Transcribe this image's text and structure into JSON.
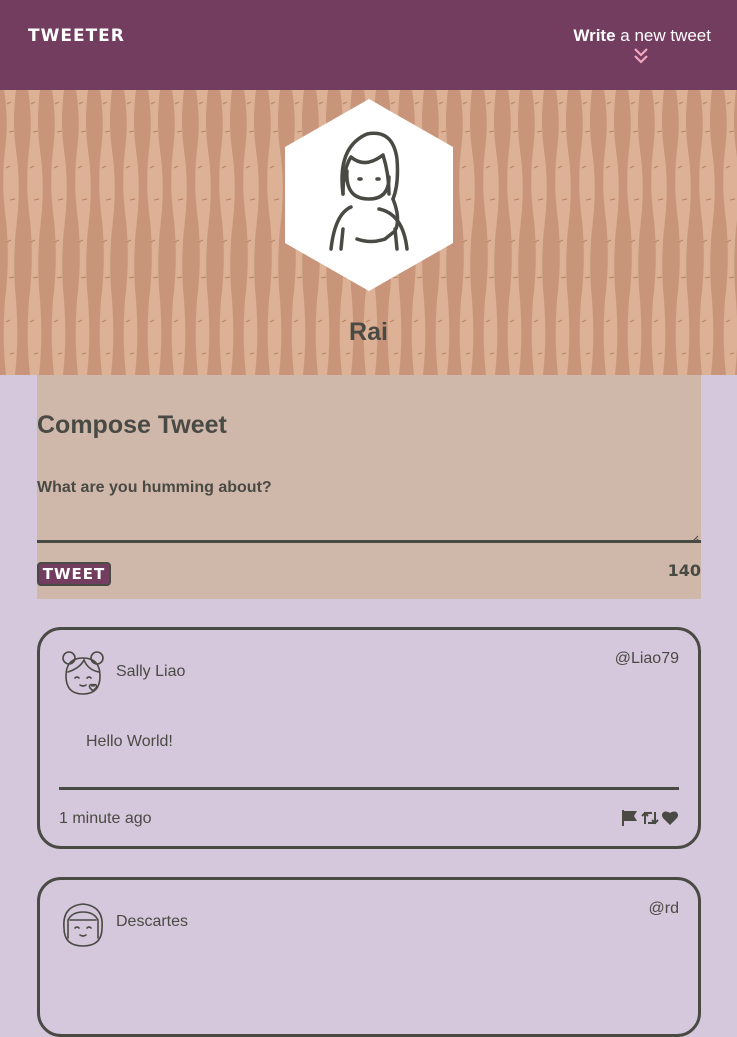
{
  "nav": {
    "brand": "TWEETER",
    "write_bold": "Write",
    "write_rest": " a new tweet",
    "toggle_icon": "double-chevron-down-icon"
  },
  "profile": {
    "name": "Rai",
    "avatar_icon": "girl-avatar-icon"
  },
  "compose": {
    "heading": "Compose Tweet",
    "placeholder": "What are you humming about?",
    "value": "",
    "button_label": "TWEET",
    "counter": "140"
  },
  "tweets": [
    {
      "name": "Sally Liao",
      "handle": "@Liao79",
      "content": "Hello World!",
      "time": "1 minute ago",
      "avatar_icon": "girl-buns-avatar-icon",
      "actions": [
        "flag-icon",
        "retweet-icon",
        "heart-icon"
      ]
    },
    {
      "name": "Descartes",
      "handle": "@rd",
      "avatar_icon": "bob-hair-avatar-icon"
    }
  ],
  "colors": {
    "nav": "#733d60",
    "page": "#d5c7dc",
    "compose": "#cfb7aa",
    "hero": "#c8957a",
    "text": "#4a4a44",
    "accent_chevron": "#f2a6bf"
  }
}
